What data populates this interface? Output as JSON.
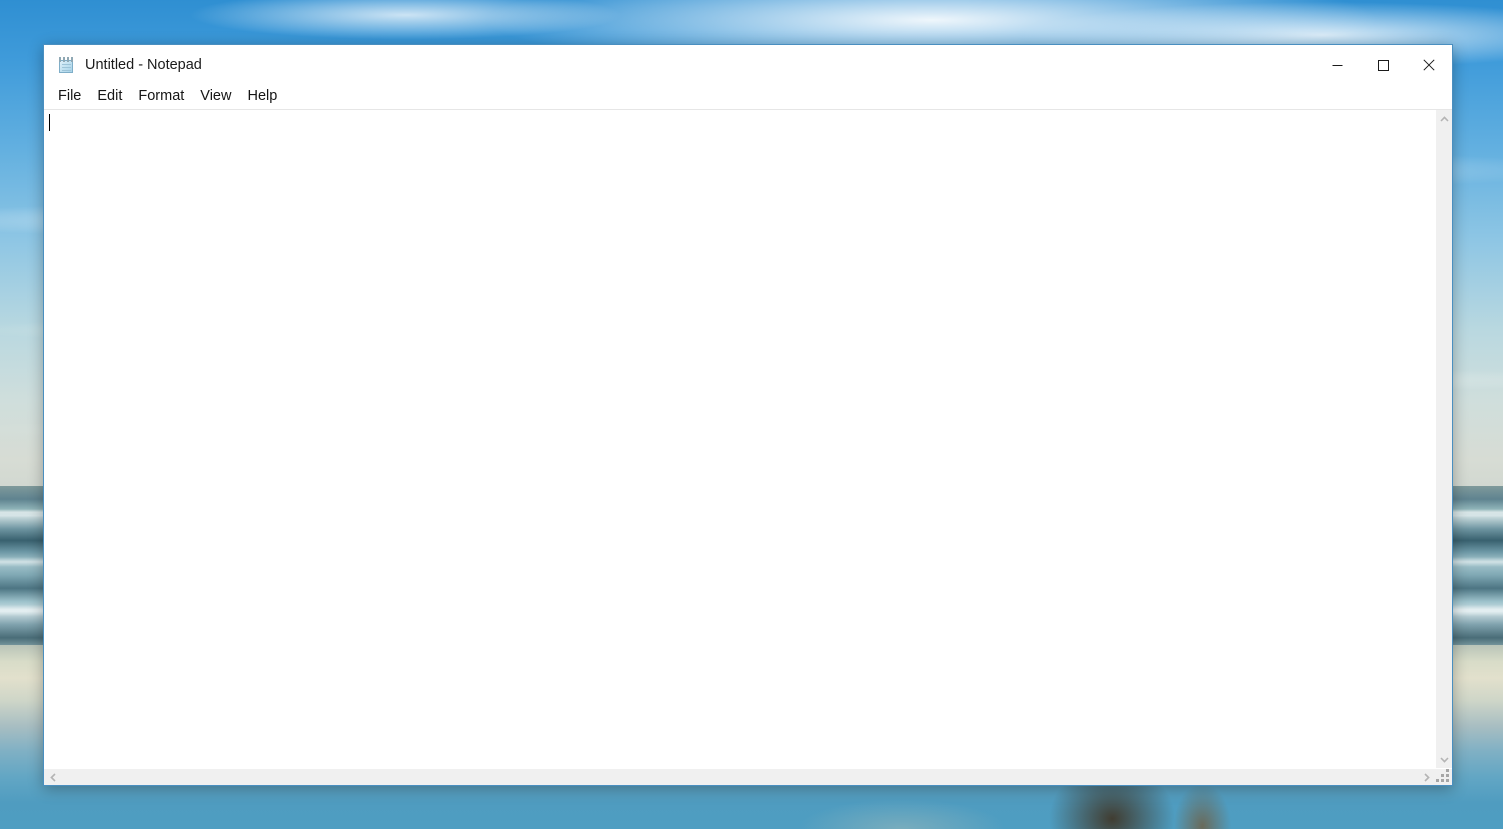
{
  "desktop": {
    "wallpaper_name": "beach-ocean-wallpaper",
    "colors": {
      "sky_blue": "#2f8fd2",
      "cloud_white": "#ffffff",
      "ocean_teal": "#4d7583",
      "wet_sand": "#d8dcc8",
      "shallow_water": "#4f9cc0"
    }
  },
  "window": {
    "title": "Untitled - Notepad",
    "app_icon": "notepad-icon",
    "controls": {
      "minimize_label": "Minimize",
      "minimize_icon": "minimize-icon",
      "maximize_label": "Maximize",
      "maximize_icon": "maximize-icon",
      "close_label": "Close",
      "close_icon": "close-icon"
    },
    "border_color": "#4a8fc0"
  },
  "menubar": {
    "items": [
      {
        "label": "File"
      },
      {
        "label": "Edit"
      },
      {
        "label": "Format"
      },
      {
        "label": "View"
      },
      {
        "label": "Help"
      }
    ]
  },
  "editor": {
    "content": "",
    "placeholder": "",
    "caret_visible": true
  },
  "scrollbars": {
    "vertical": {
      "up_icon": "chevron-up-icon",
      "down_icon": "chevron-down-icon",
      "track_color": "#f0f0f0"
    },
    "horizontal": {
      "left_icon": "chevron-left-icon",
      "right_icon": "chevron-right-icon",
      "track_color": "#f0f0f0"
    },
    "resize_grip": "resize-grip-icon"
  }
}
